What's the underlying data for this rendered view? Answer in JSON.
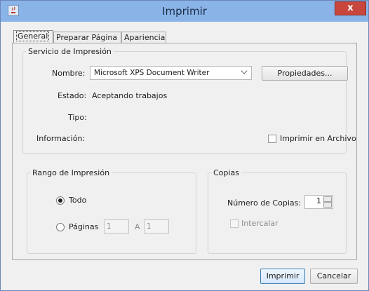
{
  "window": {
    "title": "Imprimir",
    "close_glyph": "x"
  },
  "tabs": [
    {
      "label": "General",
      "active": true
    },
    {
      "label": "Preparar Página",
      "active": false
    },
    {
      "label": "Apariencia",
      "active": false
    }
  ],
  "print_service": {
    "legend": "Servicio de Impresión",
    "name_label": "Nombre:",
    "name_value": "Microsoft XPS Document Writer",
    "properties_button": "Propiedades...",
    "status_label": "Estado:",
    "status_value": "Aceptando trabajos",
    "type_label": "Tipo:",
    "type_value": "",
    "info_label": "Información:",
    "info_value": "",
    "print_to_file_label": "Imprimir en Archivo",
    "print_to_file_checked": false
  },
  "print_range": {
    "legend": "Rango de Impresión",
    "all_label": "Todo",
    "all_selected": true,
    "pages_label": "Páginas",
    "pages_selected": false,
    "from_value": "1",
    "to_label": "A",
    "to_value": "1"
  },
  "copies": {
    "legend": "Copias",
    "count_label": "Número de Copias:",
    "count_value": "1",
    "collate_label": "Intercalar",
    "collate_checked": false,
    "collate_enabled": false
  },
  "buttons": {
    "print": "Imprimir",
    "cancel": "Cancelar"
  }
}
